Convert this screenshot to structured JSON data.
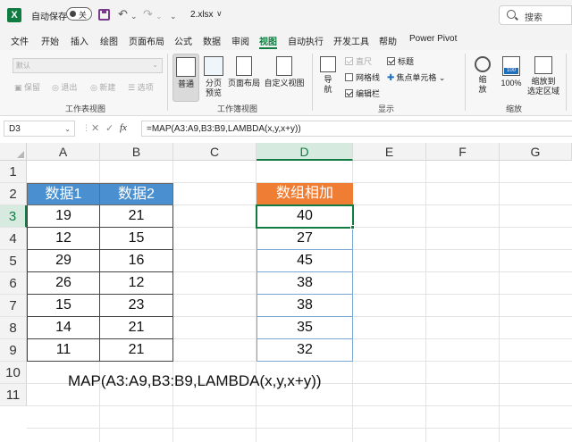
{
  "titlebar": {
    "app_logo": "X",
    "autosave_label": "自动保存",
    "autosave_state": "关",
    "filename": "2.xlsx",
    "filename_arrow": "∨",
    "undo_glyph": "↶",
    "redo_glyph": "↷",
    "dropdown_glyph": "⌄",
    "search_placeholder": "搜索"
  },
  "menu": {
    "tabs": [
      "文件",
      "开始",
      "插入",
      "绘图",
      "页面布局",
      "公式",
      "数据",
      "审阅",
      "视图",
      "自动执行",
      "开发工具",
      "帮助",
      "Power Pivot"
    ],
    "active_index": 8
  },
  "ribbon": {
    "sheet_view": {
      "select_value": "默认",
      "keep": "保留",
      "exit": "退出",
      "new": "新建",
      "options": "选项",
      "group_label": "工作表视图"
    },
    "workbook_views": {
      "normal": "普通",
      "page_break_1": "分页",
      "page_break_2": "预览",
      "page_layout": "页面布局",
      "custom_view": "自定义视图",
      "group_label": "工作簿视图"
    },
    "show": {
      "ruler": "直尺",
      "gridlines": "网格线",
      "formula_bar": "编辑栏",
      "headings": "标题",
      "focus_cell": "焦点单元格",
      "group_label": "显示"
    },
    "navigate": {
      "label_1": "导",
      "label_2": "航"
    },
    "zoom": {
      "zoom": "缩",
      "zoom_2": "放",
      "zoom_100": "100%",
      "zoom_badge": "100",
      "zoom_to_selection_1": "缩放到",
      "zoom_to_selection_2": "选定区域",
      "group_label": "缩放"
    }
  },
  "formula_bar": {
    "name_box": "D3",
    "cancel_glyph": "✕",
    "enter_glyph": "✓",
    "fx_glyph": "fx",
    "formula": "=MAP(A3:A9,B3:B9,LAMBDA(x,y,x+y))"
  },
  "grid": {
    "columns": [
      "A",
      "B",
      "C",
      "D",
      "E",
      "F",
      "G"
    ],
    "rows": [
      "1",
      "2",
      "3",
      "4",
      "5",
      "6",
      "7",
      "8",
      "9",
      "10",
      "11"
    ],
    "selected_column": "D",
    "selected_row": "3"
  },
  "table": {
    "header_a": "数据1",
    "header_b": "数据2",
    "header_d": "数组相加",
    "col_a": [
      "19",
      "12",
      "29",
      "26",
      "15",
      "14",
      "11"
    ],
    "col_b": [
      "21",
      "15",
      "16",
      "12",
      "23",
      "21",
      "21"
    ],
    "col_d": [
      "40",
      "27",
      "45",
      "38",
      "38",
      "35",
      "32"
    ]
  },
  "note": "MAP(A3:A9,B3:B9,LAMBDA(x,y,x+y))",
  "colors": {
    "excel_green": "#107c41",
    "header_blue": "#4a90d0",
    "header_orange": "#ef7d33"
  }
}
